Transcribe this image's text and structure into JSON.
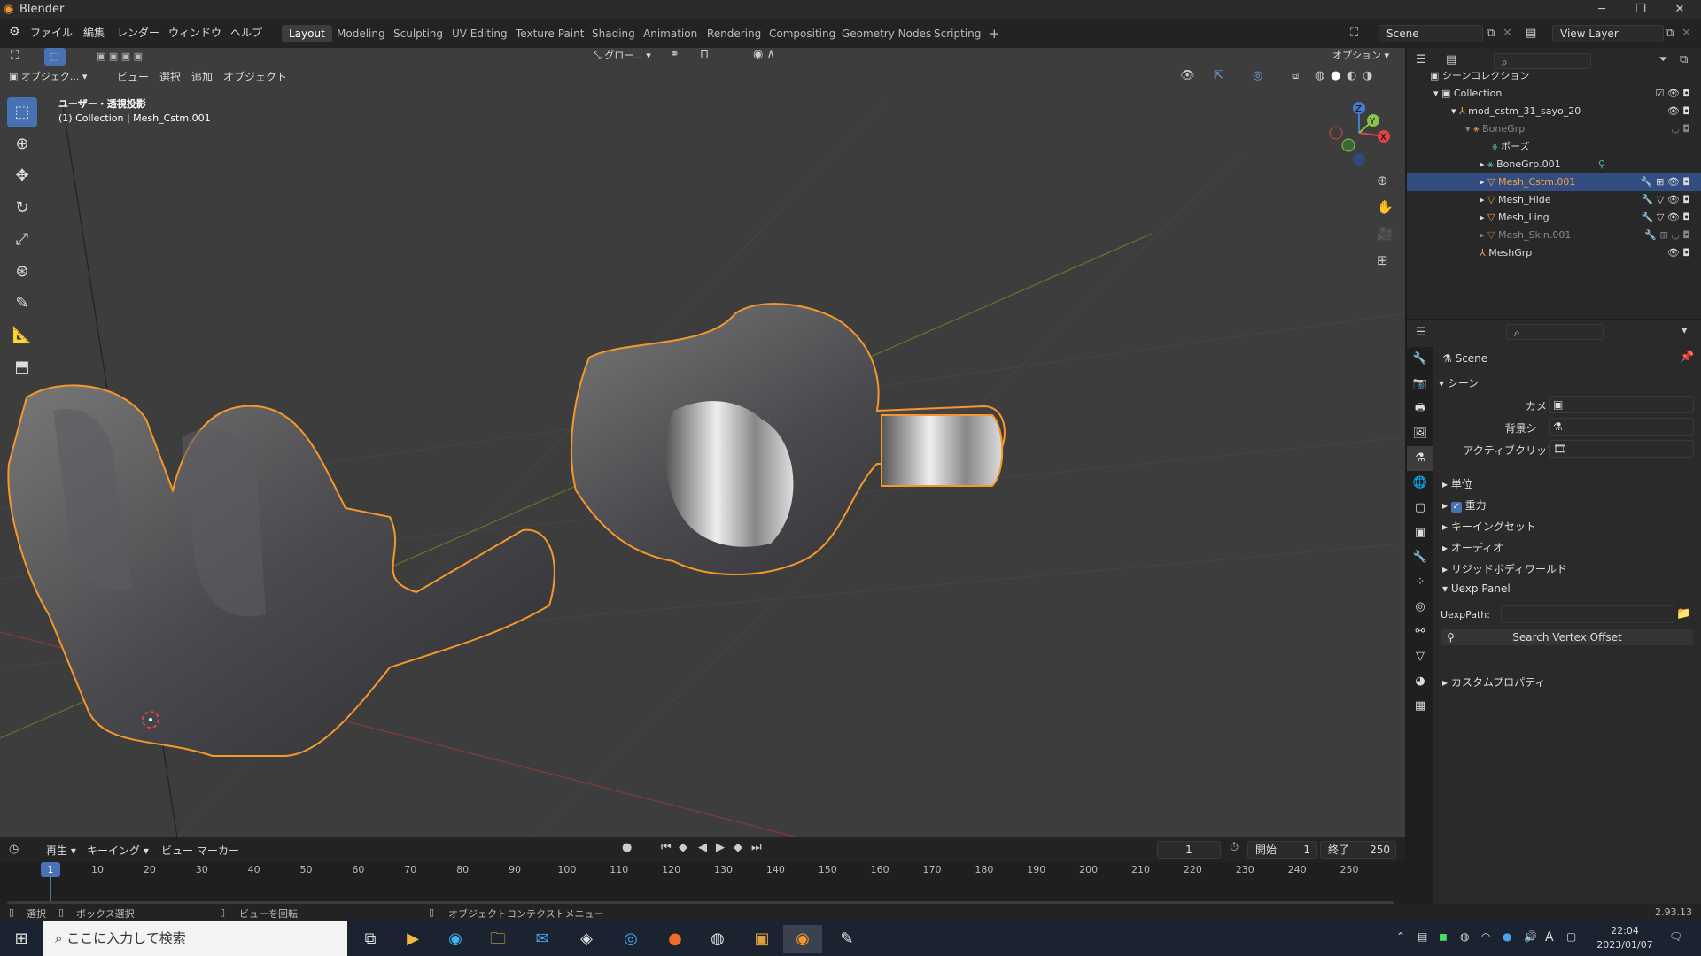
{
  "window": {
    "app_name": "Blender",
    "minimize": "─",
    "maximize": "❐",
    "close": "✕"
  },
  "menubar": {
    "items": [
      "ファイル",
      "編集",
      "レンダー",
      "ウィンドウ",
      "ヘルプ"
    ]
  },
  "workspaces": [
    "Layout",
    "Modeling",
    "Sculpting",
    "UV Editing",
    "Texture Paint",
    "Shading",
    "Animation",
    "Rendering",
    "Compositing",
    "Geometry Nodes",
    "Scripting"
  ],
  "active_workspace": "Layout",
  "scene_field": "Scene",
  "view_layer_field": "View Layer",
  "viewport": {
    "mode_dropdown": "オブジェク...",
    "menus": [
      "ビュー",
      "選択",
      "追加",
      "オブジェクト"
    ],
    "transform_orientation": "グロー...",
    "options_label": "オプション",
    "view_info_line1": "ユーザー・透視投影",
    "view_info_line2": "(1) Collection | Mesh_Cstm.001",
    "gizmo": {
      "x": "X",
      "y": "Y",
      "z": "Z"
    }
  },
  "outliner": {
    "scene_collection": "シーンコレクション",
    "rows": [
      {
        "label": "Collection",
        "selected": false,
        "dim": false
      },
      {
        "label": "mod_cstm_31_sayo_20",
        "selected": false,
        "dim": false
      },
      {
        "label": "BoneGrp",
        "selected": false,
        "dim": true
      },
      {
        "label": "ポーズ",
        "selected": false,
        "dim": false
      },
      {
        "label": "BoneGrp.001",
        "selected": false,
        "dim": false
      },
      {
        "label": "Mesh_Cstm.001",
        "selected": true,
        "dim": false
      },
      {
        "label": "Mesh_Hide",
        "selected": false,
        "dim": false
      },
      {
        "label": "Mesh_Ling",
        "selected": false,
        "dim": false
      },
      {
        "label": "Mesh_Skin.001",
        "selected": false,
        "dim": true
      },
      {
        "label": "MeshGrp",
        "selected": false,
        "dim": false
      }
    ]
  },
  "properties": {
    "header_title": "Scene",
    "scene_section": "シーン",
    "camera_label": "カメラ",
    "bg_scene_label": "背景シーン",
    "active_clip_label": "アクティブクリップ",
    "collapsed_sections": [
      "単位",
      "重力",
      "キーイングセット",
      "オーディオ",
      "リジッドボディワールド"
    ],
    "gravity_checked": true,
    "uexp_panel": "Uexp Panel",
    "uexp_path_label": "UexpPath:",
    "search_vertex_button": "Search Vertex Offset",
    "custom_props": "カスタムプロパティ"
  },
  "timeline": {
    "menus": [
      "再生",
      "キーイング",
      "ビュー",
      "マーカー"
    ],
    "current_frame": "1",
    "start_label": "開始",
    "start_value": "1",
    "end_label": "終了",
    "end_value": "250",
    "ruler": [
      "1",
      "10",
      "20",
      "30",
      "40",
      "50",
      "60",
      "70",
      "80",
      "90",
      "100",
      "110",
      "120",
      "130",
      "140",
      "150",
      "160",
      "170",
      "180",
      "190",
      "200",
      "210",
      "220",
      "230",
      "240",
      "250"
    ]
  },
  "statusbar": {
    "select": "選択",
    "box_select": "ボックス選択",
    "rotate_view": "ビューを回転",
    "context_menu": "オブジェクトコンテクストメニュー",
    "version": "2.93.13"
  },
  "taskbar": {
    "search_placeholder": "ここに入力して検索",
    "time": "22:04",
    "date": "2023/01/07",
    "ime": "A"
  },
  "colors": {
    "accent": "#4772b3",
    "selection_outline": "#f5972b",
    "viewport_bg": "#3d3d3d"
  }
}
